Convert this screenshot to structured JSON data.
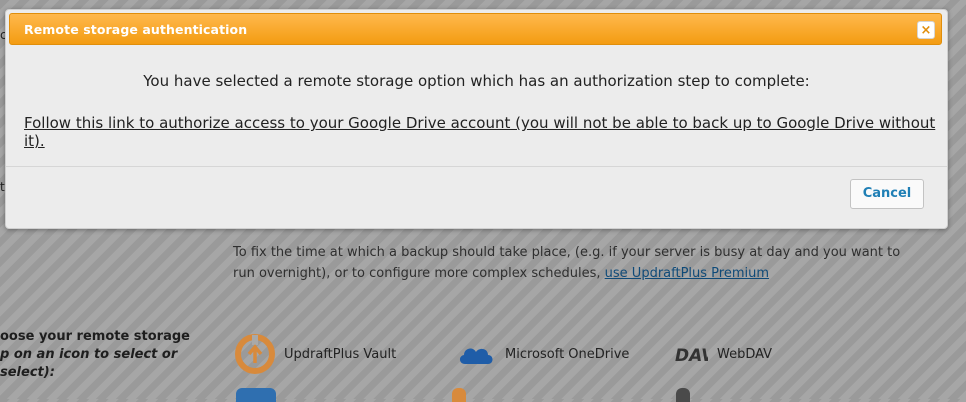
{
  "modal": {
    "title": "Remote storage authentication",
    "close_symbol": "×",
    "message": "You have selected a remote storage option which has an authorization step to complete:",
    "auth_link": "Follow this link to authorize access to your Google Drive account (you will not be able to back up to Google Drive without it).",
    "cancel_label": "Cancel"
  },
  "background": {
    "edge_letter_1": "c",
    "edge_letter_2": "t",
    "schedule_help_text": "To fix the time at which a backup should take place, (e.g. if your server is busy at day and you want to run overnight), or to configure more complex schedules, ",
    "schedule_help_link": "use UpdraftPlus Premium",
    "remote_storage_label_line1": "oose your remote storage",
    "remote_storage_label_line2": "p on an icon to select or",
    "remote_storage_label_line3": "select):",
    "storage_options": [
      {
        "label": "UpdraftPlus Vault",
        "icon": "updraftplus-vault-icon"
      },
      {
        "label": "Microsoft OneDrive",
        "icon": "onedrive-cloud-icon"
      },
      {
        "label": "WebDAV",
        "icon": "webdav-icon"
      }
    ]
  },
  "colors": {
    "titlebar": "#f39c12",
    "link_blue": "#1f7fb5",
    "modal_bg": "#ececec"
  }
}
